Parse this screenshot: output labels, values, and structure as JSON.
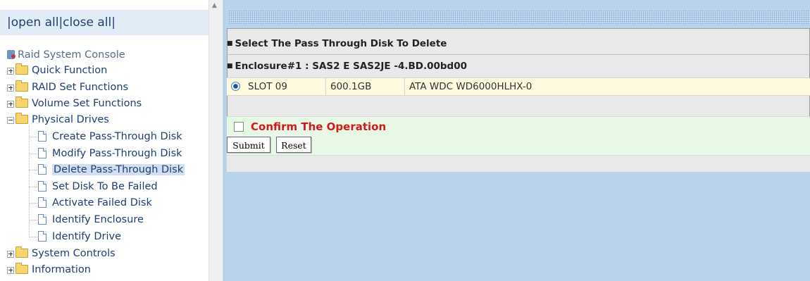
{
  "nav": {
    "open_all": "open all",
    "close_all": "close all",
    "separator": "|"
  },
  "tree": {
    "root": "Raid System Console",
    "folders": [
      {
        "label": "Quick Function",
        "expanded": false
      },
      {
        "label": "RAID Set Functions",
        "expanded": false
      },
      {
        "label": "Volume Set Functions",
        "expanded": false
      },
      {
        "label": "Physical Drives",
        "expanded": true
      },
      {
        "label": "System Controls",
        "expanded": false
      },
      {
        "label": "Information",
        "expanded": false
      }
    ],
    "physical_drives_items": [
      {
        "label": "Create Pass-Through Disk",
        "selected": false
      },
      {
        "label": "Modify Pass-Through Disk",
        "selected": false
      },
      {
        "label": "Delete Pass-Through Disk",
        "selected": true
      },
      {
        "label": "Set Disk To Be Failed",
        "selected": false
      },
      {
        "label": "Activate Failed Disk",
        "selected": false
      },
      {
        "label": "Identify Enclosure",
        "selected": false
      },
      {
        "label": "Identify Drive",
        "selected": false
      }
    ]
  },
  "content": {
    "section_title": "Select The Pass Through Disk To Delete",
    "enclosure_title": "Enclosure#1 : SAS2 E SAS2JE -4.BD.00bd00",
    "disk": {
      "slot": "SLOT 09",
      "capacity": "600.1GB",
      "model": "ATA WDC WD6000HLHX-0",
      "selected": true
    },
    "confirm_label": "Confirm The Operation",
    "confirm_checked": false,
    "submit_label": "Submit",
    "reset_label": "Reset"
  },
  "colors": {
    "tree_text": "#1f3f74",
    "confirm_text": "#d11b1b",
    "right_background": "#b9d3ec",
    "disk_row_background": "#fdfae0",
    "confirm_row_background": "#e8f8e6"
  }
}
